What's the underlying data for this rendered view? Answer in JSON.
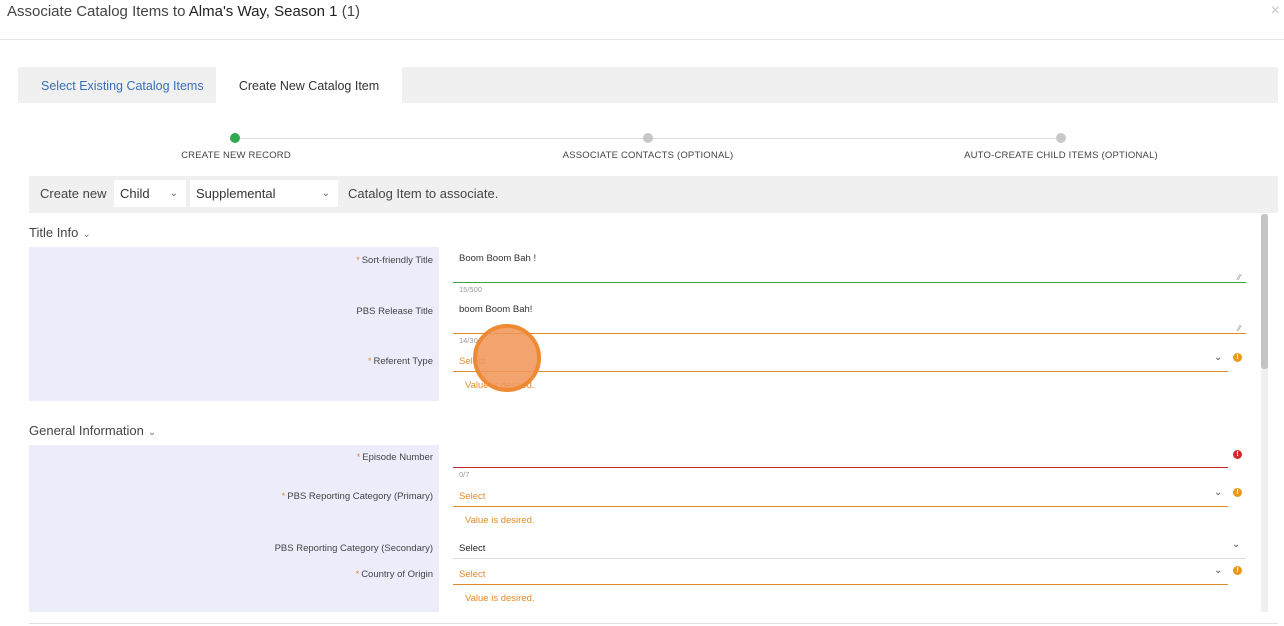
{
  "header": {
    "title_prefix": "Associate Catalog Items to ",
    "title_bold": "Alma's Way, Season 1",
    "title_suffix": " (1)",
    "close": "×"
  },
  "tabs": [
    {
      "label": "Select Existing Catalog Items",
      "active": false
    },
    {
      "label": "Create New Catalog Item",
      "active": true
    }
  ],
  "stepper": [
    {
      "label": "CREATE NEW RECORD",
      "status": "active",
      "color": "#2fa84f"
    },
    {
      "label": "ASSOCIATE CONTACTS (OPTIONAL)",
      "status": "pending",
      "color": "#c8c8c8"
    },
    {
      "label": "AUTO-CREATE CHILD ITEMS (OPTIONAL)",
      "status": "pending",
      "color": "#c8c8c8"
    }
  ],
  "create_bar": {
    "prefix": "Create new",
    "type_value": "Child",
    "subtype_value": "Supplemental",
    "suffix": "Catalog Item to associate."
  },
  "sections": {
    "title_info": {
      "title": "Title Info",
      "fields": {
        "sort_title": {
          "required": "*",
          "label": "Sort-friendly Title",
          "value": "Boom Boom Bah !",
          "counter": "15/500"
        },
        "pbs_release_title": {
          "label": "PBS Release Title",
          "value": "boom Boom Bah!",
          "counter": "14/30"
        },
        "referent_type": {
          "required": "*",
          "label": "Referent Type",
          "value": "Select",
          "hint": "Value is desired."
        }
      }
    },
    "general_info": {
      "title": "General Information",
      "fields": {
        "episode_number": {
          "required": "*",
          "label": "Episode Number",
          "value": "",
          "counter": "0/7"
        },
        "pbs_reporting_primary": {
          "required": "*",
          "label": "PBS Reporting Category (Primary)",
          "value": "Select",
          "hint": "Value is desired."
        },
        "pbs_reporting_secondary": {
          "label": "PBS Reporting Category (Secondary)",
          "value": "Select"
        },
        "country_of_origin": {
          "required": "*",
          "label": "Country of Origin",
          "value": "Select",
          "hint": "Value is desired."
        }
      }
    }
  },
  "icons": {
    "warning": "!",
    "error": "!",
    "chevron": "⌄",
    "resize": "⁄⁄"
  },
  "colors": {
    "valid": "#3aa547",
    "warning": "#e08a2c",
    "error": "#c82828",
    "link": "#3a6fb7",
    "panel": "#ececfb"
  }
}
